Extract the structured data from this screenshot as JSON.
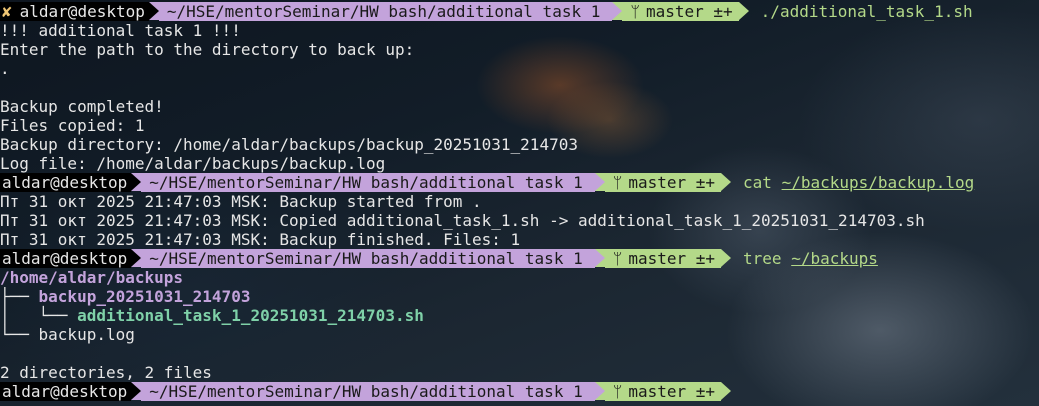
{
  "theme": {
    "path_segment_color": "#c3a3db",
    "git_segment_color": "#b4d989",
    "command_color": "#b4d989",
    "directory_color": "#c3a3db",
    "executable_color": "#7fd1a8"
  },
  "prompt": {
    "status_icon": "cross-icon",
    "status_glyph": "✘",
    "user": "aldar@desktop",
    "path": "~/HSE/mentorSeminar/HW bash/additional task 1",
    "git_icon": "git-branch-icon",
    "git_glyph": "ᛘ",
    "branch": "master",
    "git_status": "±+"
  },
  "blocks": [
    {
      "command": "./additional_task_1.sh",
      "output": [
        "!!! additional task 1 !!!",
        "Enter the path to the directory to back up:",
        ".",
        "",
        "Backup completed!",
        "Files copied: 1",
        "Backup directory: /home/aldar/backups/backup_20251031_214703",
        "Log file: /home/aldar/backups/backup.log"
      ]
    },
    {
      "command_name": "cat",
      "command_arg": "~/backups/backup.log",
      "output": [
        "Пт 31 окт 2025 21:47:03 MSK: Backup started from .",
        "Пт 31 окт 2025 21:47:03 MSK: Copied additional_task_1.sh -> additional_task_1_20251031_214703.sh",
        "Пт 31 окт 2025 21:47:03 MSK: Backup finished. Files: 1"
      ]
    },
    {
      "command_name": "tree",
      "command_arg": "~/backups",
      "tree": {
        "root": "/home/aldar/backups",
        "branch1_prefix": "├── ",
        "dir": "backup_20251031_214703",
        "branch2_prefix": "│   └── ",
        "file_in_dir": "additional_task_1_20251031_214703.sh",
        "branch3_prefix": "└── ",
        "file": "backup.log",
        "blank": "",
        "summary": "2 directories, 2 files"
      }
    }
  ]
}
